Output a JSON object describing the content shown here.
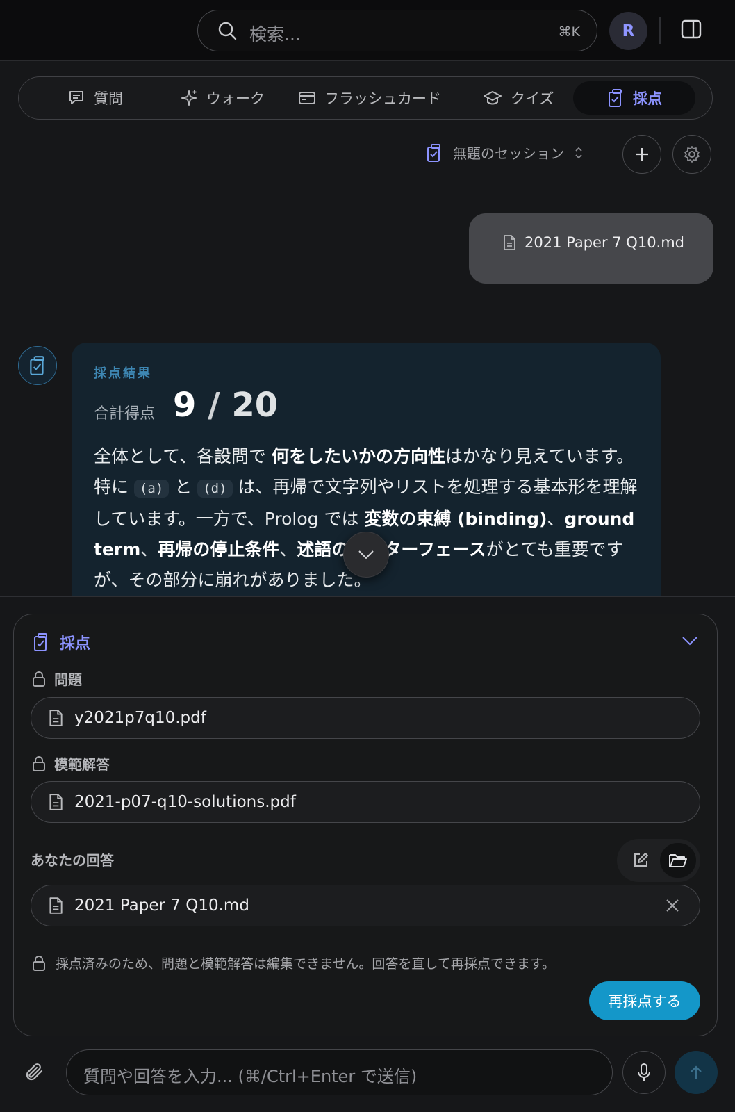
{
  "search": {
    "placeholder": "検索...",
    "shortcut": "⌘K"
  },
  "user": {
    "avatar_initial": "R"
  },
  "tabs": [
    {
      "label": "質問",
      "icon": "message-square-icon",
      "active": false
    },
    {
      "label": "ウォーク",
      "icon": "sparkles-icon",
      "active": false
    },
    {
      "label": "フラッシュカード",
      "icon": "card-icon",
      "active": false
    },
    {
      "label": "クイズ",
      "icon": "graduation-cap-icon",
      "active": false
    },
    {
      "label": "採点",
      "icon": "clipboard-check-icon",
      "active": true
    }
  ],
  "session": {
    "title": "無題のセッション"
  },
  "user_message": {
    "attachment": "2021 Paper 7 Q10.md"
  },
  "grading_result": {
    "heading": "採点結果",
    "total_label": "合計得点",
    "score": "9",
    "separator": "/",
    "max_score": "20",
    "summary": {
      "s1": "全体として、各設問で ",
      "b1": "何をしたいかの方向性",
      "s2": "はかなり見えています。特に ",
      "c1": "(a)",
      "s3": " と ",
      "c2": "(d)",
      "s4": " は、再帰で文字列やリストを処理する基本形を理解しています。一方で、Prolog では ",
      "b2": "変数の束縛 (binding)",
      "s5": "、",
      "b3": "ground term",
      "s6": "、",
      "b4": "再帰の停止条件",
      "s7": "、",
      "b5": "述語のインターフェース",
      "s8": "がとても重要ですが、その部分に崩れがありました。"
    }
  },
  "grading_panel": {
    "title": "採点",
    "problem_label": "問題",
    "problem_file": "y2021p7q10.pdf",
    "solution_label": "模範解答",
    "solution_file": "2021-p07-q10-solutions.pdf",
    "answer_label": "あなたの回答",
    "answer_file": "2021 Paper 7 Q10.md",
    "lock_note": "採点済みのため、問題と模範解答は編集できません。回答を直して再採点できます。",
    "regrade_button": "再採点する"
  },
  "composer": {
    "placeholder": "質問や回答を入力... (⌘/Ctrl+Enter で送信)"
  },
  "colors": {
    "accent": "#8c93ff",
    "primary_button": "#1497c9",
    "card_bg": "#14232e"
  }
}
